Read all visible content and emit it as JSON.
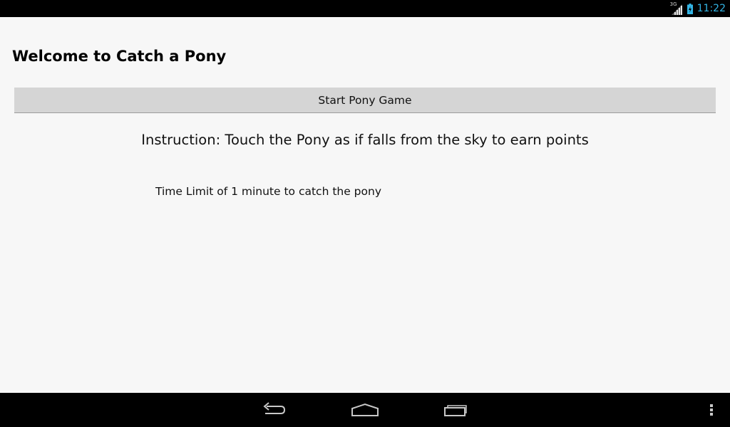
{
  "status_bar": {
    "network_type": "3G",
    "time": "11:22",
    "icons": [
      "signal-icon",
      "battery-charging-icon"
    ]
  },
  "app": {
    "title": "Welcome to Catch a Pony",
    "start_button_label": "Start Pony Game",
    "instruction": "Instruction: Touch the Pony as if falls from the sky to earn points",
    "time_limit": "Time Limit of 1 minute to catch the pony"
  },
  "nav_bar": {
    "buttons": [
      "back-icon",
      "home-icon",
      "recent-apps-icon",
      "overflow-menu-icon"
    ]
  },
  "colors": {
    "background": "#f7f7f7",
    "button": "#d5d5d5",
    "clock": "#33b5e5",
    "bars": "#000000"
  }
}
